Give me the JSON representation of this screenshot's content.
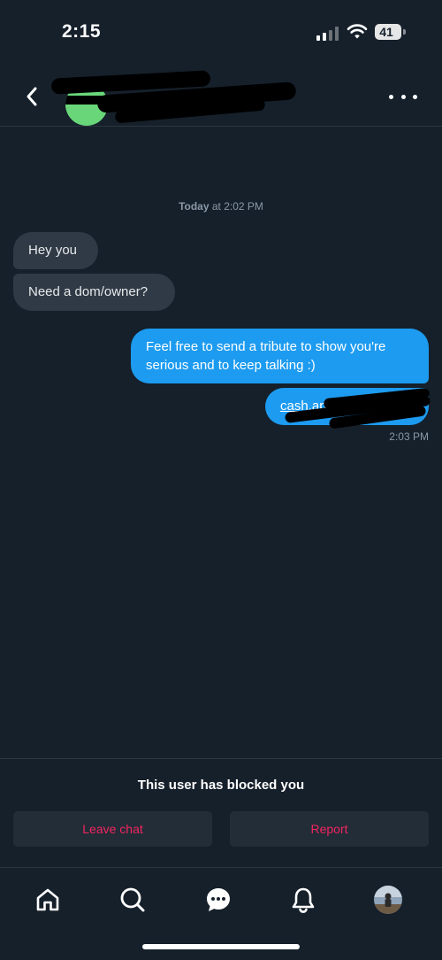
{
  "status_bar": {
    "time": "2:15",
    "battery": "41"
  },
  "conversation": {
    "timestamp_day": "Today",
    "timestamp_at": "at 2:02 PM",
    "messages": [
      {
        "direction": "received",
        "text": "Hey you"
      },
      {
        "direction": "received",
        "text": "Need a dom/owner?"
      },
      {
        "direction": "sent",
        "text": "Feel free to send a tribute to show you're serious and to keep talking :)"
      },
      {
        "direction": "sent",
        "text": "cash.app/$"
      }
    ],
    "sent_time": "2:03 PM"
  },
  "blocked": {
    "notice": "This user has blocked you",
    "leave_label": "Leave chat",
    "report_label": "Report"
  },
  "tab_bar": {
    "icons": [
      "home-icon",
      "search-icon",
      "messages-icon",
      "notifications-icon",
      "profile-avatar"
    ]
  },
  "colors": {
    "background": "#15202b",
    "sent_bubble": "#1d9bf0",
    "received_bubble": "#2f3a46",
    "danger": "#f4245e",
    "online": "#69d779"
  }
}
